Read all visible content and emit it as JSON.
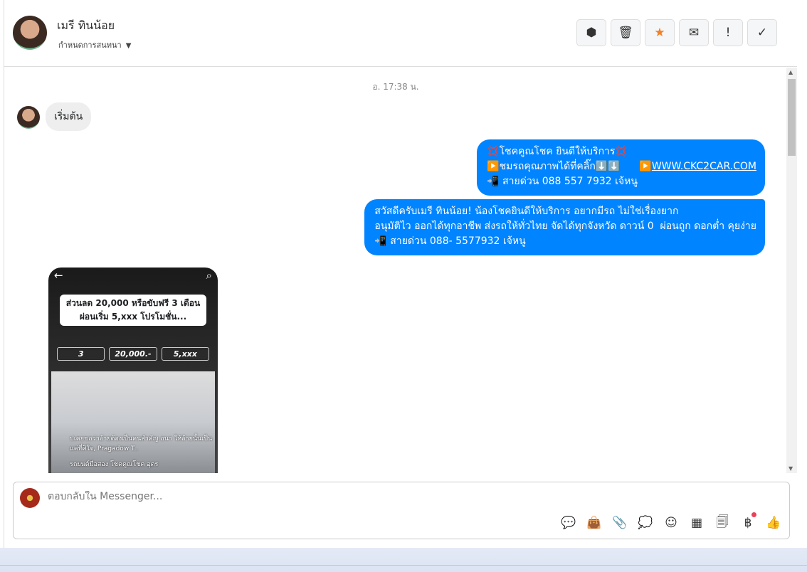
{
  "header": {
    "name": "เมรี ทินน้อย",
    "subtitle": "กำหนดการสนทนา",
    "caret": "▼",
    "actions": [
      {
        "icon": "alert-octagon-icon",
        "glyph": "⬢"
      },
      {
        "icon": "trash-icon",
        "glyph": "🗑"
      },
      {
        "icon": "star-icon",
        "glyph": "★",
        "color": "#f48024"
      },
      {
        "icon": "envelope-icon",
        "glyph": "✉"
      },
      {
        "icon": "exclamation-icon",
        "glyph": "!"
      },
      {
        "icon": "check-icon",
        "glyph": "✓"
      }
    ]
  },
  "chat": {
    "timestamp": "อ. 17:38 น.",
    "received": "เริ่มต้น",
    "sent1": {
      "line1": "💢โชคคูณโชค ยินดีให้บริการ💢",
      "line2": "▶️ชมรถคุณภาพได้ที่คลิ๊ก⬇️⬇️      ▶️",
      "link": "WWW.CKC2CAR.COM",
      "line3": "📲 สายด่วน 088 557 7932 เจ้หนู"
    },
    "sent2": "สวัสดีครับเมรี ทินน้อย! น้องโชคยินดีให้บริการ อยากมีรถ ไม่ใช่เรื่องยาก\nอนุมัติไว ออกได้ทุกอาชีพ ส่งรถให้ทั่วไทย จัดได้ทุกจังหวัด ดาวน์ 0  ผ่อนถูก ดอกต่ำ คุยง่าย\n📲 สายด่วน 088- 5577932 เจ้หนู",
    "image": {
      "promo": "ส่วนลด 20,000 หรือขับฟรี 3 เดือน ผ่อนเริ่ม 5,xxx โปรโมชั่น...",
      "box1": "3",
      "box2": "20,000.-",
      "box3": "5,xxx",
      "caption1": "ปเคยขอว่าอ้ายต้องเป็นคนสำคัญ อนา ให้อ้ายนั้นเป็นแค่ที่ศิใจ, Pragadow T..",
      "caption2": "รถยนต์มือสอง โชคคูณโชค อุดร"
    }
  },
  "composer": {
    "placeholder": "ตอบกลับใน Messenger...",
    "tools": [
      {
        "icon": "saved-reply-icon",
        "glyph": "💬"
      },
      {
        "icon": "shop-bag-icon",
        "glyph": "👜"
      },
      {
        "icon": "paperclip-icon",
        "glyph": "📎"
      },
      {
        "icon": "chat-dots-icon",
        "glyph": "💭"
      },
      {
        "icon": "emoji-icon",
        "glyph": "☺"
      },
      {
        "icon": "table-icon",
        "glyph": "▦"
      },
      {
        "icon": "notes-icon",
        "glyph": "🗐"
      },
      {
        "icon": "baht-icon",
        "glyph": "฿"
      },
      {
        "icon": "thumbs-up-icon",
        "glyph": "👍"
      }
    ]
  }
}
